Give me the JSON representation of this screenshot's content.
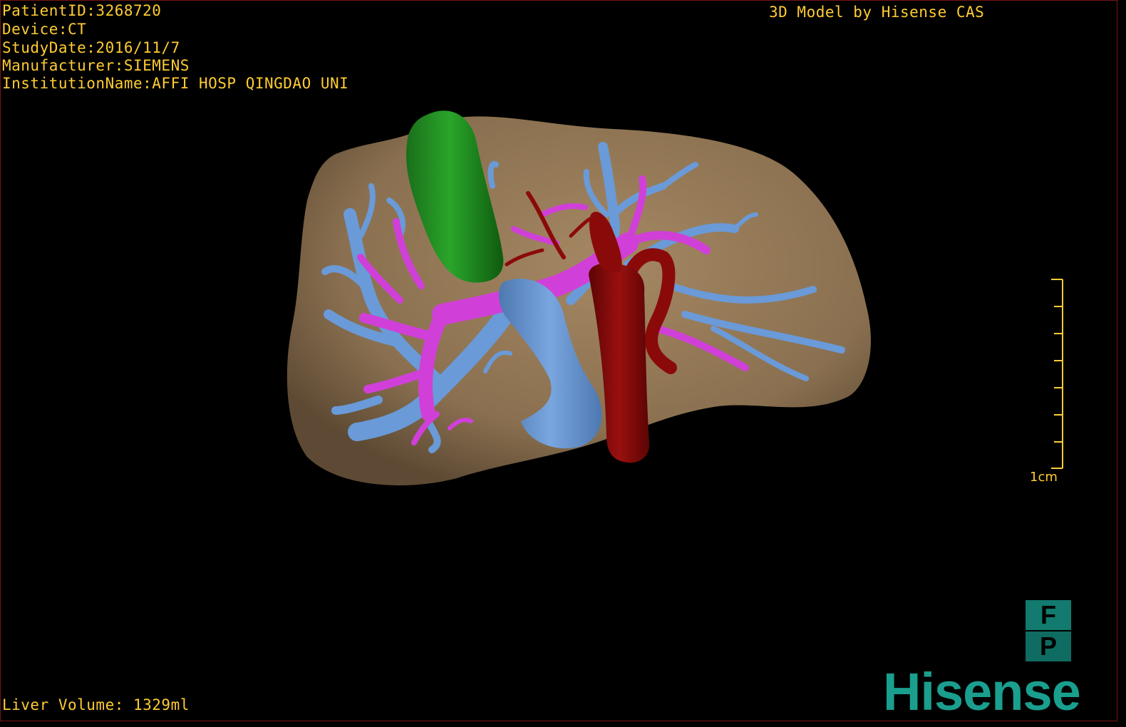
{
  "overlay": {
    "patient_id": "PatientID:3268720",
    "device": "Device:CT",
    "study_date": "StudyDate:2016/11/7",
    "manufacturer": "Manufacturer:SIEMENS",
    "institution": "InstitutionName:AFFI HOSP QINGDAO UNI",
    "credit": "3D Model by Hisense CAS",
    "liver_volume": "Liver Volume: 1329ml"
  },
  "scale_bar": {
    "label": "1cm"
  },
  "orientation": {
    "top": "F",
    "bottom": "P"
  },
  "brand": {
    "name": "Hisense"
  },
  "colors": {
    "overlay_text": "#ffcc33",
    "liver": "#8a7050",
    "gallbladder": "#1f8a1f",
    "portal_vein": "#6a9ad8",
    "hepatic_vein": "#d040d8",
    "artery": "#8a0a0a",
    "brand": "#1a9e8e"
  },
  "model_parts": [
    "liver-surface",
    "gallbladder",
    "portal-vein",
    "hepatic-vein",
    "aorta",
    "hepatic-artery"
  ]
}
